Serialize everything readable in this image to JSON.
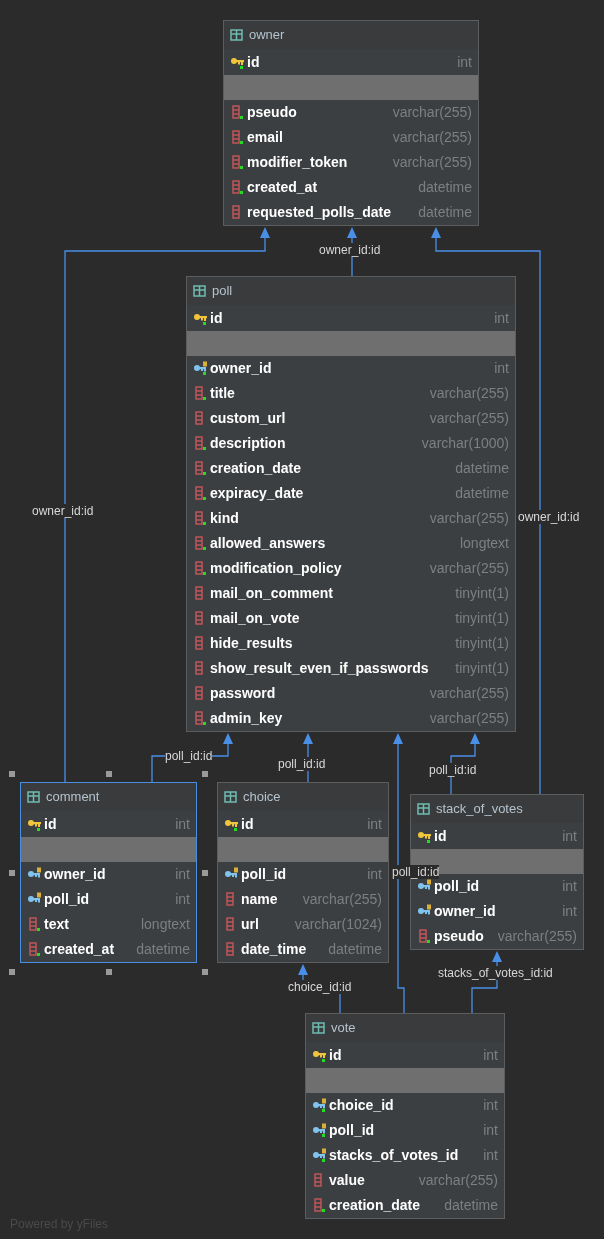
{
  "tables": [
    {
      "name": "owner",
      "selected": false,
      "columns": [
        {
          "name": "id",
          "type": "int",
          "kind": "pk",
          "not_null": true
        },
        {
          "name": "pseudo",
          "type": "varchar(255)",
          "kind": "column",
          "not_null": true
        },
        {
          "name": "email",
          "type": "varchar(255)",
          "kind": "column",
          "not_null": true
        },
        {
          "name": "modifier_token",
          "type": "varchar(255)",
          "kind": "column",
          "not_null": true
        },
        {
          "name": "created_at",
          "type": "datetime",
          "kind": "column",
          "not_null": true
        },
        {
          "name": "requested_polls_date",
          "type": "datetime",
          "kind": "column",
          "not_null": false
        }
      ]
    },
    {
      "name": "poll",
      "selected": false,
      "columns": [
        {
          "name": "id",
          "type": "int",
          "kind": "pk",
          "not_null": true
        },
        {
          "name": "owner_id",
          "type": "int",
          "kind": "fk",
          "not_null": true
        },
        {
          "name": "title",
          "type": "varchar(255)",
          "kind": "column",
          "not_null": true
        },
        {
          "name": "custom_url",
          "type": "varchar(255)",
          "kind": "column",
          "not_null": false
        },
        {
          "name": "description",
          "type": "varchar(1000)",
          "kind": "column",
          "not_null": true
        },
        {
          "name": "creation_date",
          "type": "datetime",
          "kind": "column",
          "not_null": true
        },
        {
          "name": "expiracy_date",
          "type": "datetime",
          "kind": "column",
          "not_null": true
        },
        {
          "name": "kind",
          "type": "varchar(255)",
          "kind": "column",
          "not_null": true
        },
        {
          "name": "allowed_answers",
          "type": "longtext",
          "kind": "column",
          "not_null": true
        },
        {
          "name": "modification_policy",
          "type": "varchar(255)",
          "kind": "column",
          "not_null": true
        },
        {
          "name": "mail_on_comment",
          "type": "tinyint(1)",
          "kind": "column",
          "not_null": false
        },
        {
          "name": "mail_on_vote",
          "type": "tinyint(1)",
          "kind": "column",
          "not_null": false
        },
        {
          "name": "hide_results",
          "type": "tinyint(1)",
          "kind": "column",
          "not_null": false
        },
        {
          "name": "show_result_even_if_passwords",
          "type": "tinyint(1)",
          "kind": "column",
          "not_null": false
        },
        {
          "name": "password",
          "type": "varchar(255)",
          "kind": "column",
          "not_null": false
        },
        {
          "name": "admin_key",
          "type": "varchar(255)",
          "kind": "column",
          "not_null": true
        }
      ]
    },
    {
      "name": "comment",
      "selected": true,
      "columns": [
        {
          "name": "id",
          "type": "int",
          "kind": "pk",
          "not_null": true
        },
        {
          "name": "owner_id",
          "type": "int",
          "kind": "fk",
          "not_null": false
        },
        {
          "name": "poll_id",
          "type": "int",
          "kind": "fk",
          "not_null": false
        },
        {
          "name": "text",
          "type": "longtext",
          "kind": "column",
          "not_null": true
        },
        {
          "name": "created_at",
          "type": "datetime",
          "kind": "column",
          "not_null": true
        }
      ]
    },
    {
      "name": "choice",
      "selected": false,
      "columns": [
        {
          "name": "id",
          "type": "int",
          "kind": "pk",
          "not_null": true
        },
        {
          "name": "poll_id",
          "type": "int",
          "kind": "fk",
          "not_null": false
        },
        {
          "name": "name",
          "type": "varchar(255)",
          "kind": "column",
          "not_null": false
        },
        {
          "name": "url",
          "type": "varchar(1024)",
          "kind": "column",
          "not_null": false
        },
        {
          "name": "date_time",
          "type": "datetime",
          "kind": "column",
          "not_null": false
        }
      ]
    },
    {
      "name": "stack_of_votes",
      "selected": false,
      "columns": [
        {
          "name": "id",
          "type": "int",
          "kind": "pk",
          "not_null": true
        },
        {
          "name": "poll_id",
          "type": "int",
          "kind": "fk",
          "not_null": false
        },
        {
          "name": "owner_id",
          "type": "int",
          "kind": "fk",
          "not_null": false
        },
        {
          "name": "pseudo",
          "type": "varchar(255)",
          "kind": "column",
          "not_null": true
        }
      ]
    },
    {
      "name": "vote",
      "selected": false,
      "columns": [
        {
          "name": "id",
          "type": "int",
          "kind": "pk",
          "not_null": true
        },
        {
          "name": "choice_id",
          "type": "int",
          "kind": "fk",
          "not_null": true
        },
        {
          "name": "poll_id",
          "type": "int",
          "kind": "fk",
          "not_null": true
        },
        {
          "name": "stacks_of_votes_id",
          "type": "int",
          "kind": "fk",
          "not_null": true
        },
        {
          "name": "value",
          "type": "varchar(255)",
          "kind": "column",
          "not_null": false
        },
        {
          "name": "creation_date",
          "type": "datetime",
          "kind": "column",
          "not_null": true
        }
      ]
    }
  ],
  "relations": [
    {
      "label": "owner_id:id"
    },
    {
      "label": "owner_id:id"
    },
    {
      "label": "owner_id:id"
    },
    {
      "label": "poll_id:id"
    },
    {
      "label": "poll_id:id"
    },
    {
      "label": "poll_id:id"
    },
    {
      "label": "poll_id:id"
    },
    {
      "label": "choice_id:id"
    },
    {
      "label": "stacks_of_votes_id:id"
    }
  ],
  "footer": "Powered by yFiles"
}
